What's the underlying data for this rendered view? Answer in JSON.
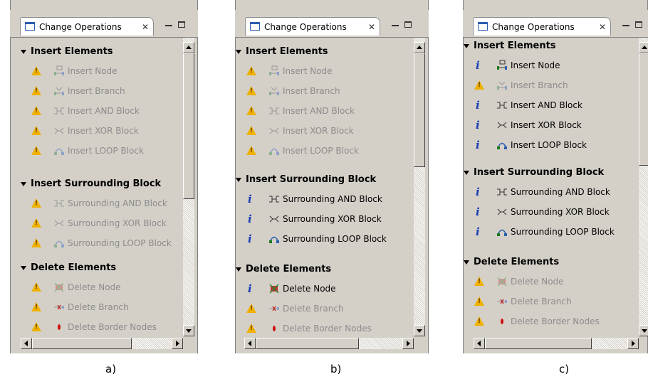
{
  "panels": [
    {
      "tab_title": "Change Operations",
      "sections": [
        {
          "title": "Insert Elements",
          "items": [
            {
              "label": "Insert Node",
              "status": "warning",
              "enabled": false,
              "icon": "insert-node-icon"
            },
            {
              "label": "Insert Branch",
              "status": "warning",
              "enabled": false,
              "icon": "insert-branch-icon"
            },
            {
              "label": "Insert AND Block",
              "status": "warning",
              "enabled": false,
              "icon": "and-block-icon"
            },
            {
              "label": "Insert XOR Block",
              "status": "warning",
              "enabled": false,
              "icon": "xor-block-icon"
            },
            {
              "label": "Insert LOOP Block",
              "status": "warning",
              "enabled": false,
              "icon": "loop-block-icon"
            }
          ]
        },
        {
          "title": "Insert Surrounding Block",
          "items": [
            {
              "label": "Surrounding AND Block",
              "status": "warning",
              "enabled": false,
              "icon": "and-block-icon"
            },
            {
              "label": "Surrounding XOR Block",
              "status": "warning",
              "enabled": false,
              "icon": "xor-block-icon"
            },
            {
              "label": "Surrounding LOOP Block",
              "status": "warning",
              "enabled": false,
              "icon": "loop-block-icon"
            }
          ]
        },
        {
          "title": "Delete Elements",
          "items": [
            {
              "label": "Delete Node",
              "status": "warning",
              "enabled": false,
              "icon": "delete-node-icon"
            },
            {
              "label": "Delete Branch",
              "status": "warning",
              "enabled": false,
              "icon": "delete-branch-icon"
            },
            {
              "label": "Delete Border Nodes",
              "status": "warning",
              "enabled": false,
              "icon": "delete-border-nodes-icon"
            }
          ]
        }
      ],
      "caption": "a)"
    },
    {
      "tab_title": "Change Operations",
      "sections": [
        {
          "title": "Insert Elements",
          "items": [
            {
              "label": "Insert Node",
              "status": "warning",
              "enabled": false,
              "icon": "insert-node-icon"
            },
            {
              "label": "Insert Branch",
              "status": "warning",
              "enabled": false,
              "icon": "insert-branch-icon"
            },
            {
              "label": "Insert AND Block",
              "status": "warning",
              "enabled": false,
              "icon": "and-block-icon"
            },
            {
              "label": "Insert XOR Block",
              "status": "warning",
              "enabled": false,
              "icon": "xor-block-icon"
            },
            {
              "label": "Insert LOOP Block",
              "status": "warning",
              "enabled": false,
              "icon": "loop-block-icon"
            }
          ]
        },
        {
          "title": "Insert Surrounding Block",
          "items": [
            {
              "label": "Surrounding AND Block",
              "status": "info",
              "enabled": true,
              "icon": "and-block-icon"
            },
            {
              "label": "Surrounding XOR Block",
              "status": "info",
              "enabled": true,
              "icon": "xor-block-icon"
            },
            {
              "label": "Surrounding LOOP Block",
              "status": "info",
              "enabled": true,
              "icon": "loop-block-icon"
            }
          ]
        },
        {
          "title": "Delete Elements",
          "items": [
            {
              "label": "Delete Node",
              "status": "info",
              "enabled": true,
              "icon": "delete-node-icon"
            },
            {
              "label": "Delete Branch",
              "status": "warning",
              "enabled": false,
              "icon": "delete-branch-icon"
            },
            {
              "label": "Delete Border Nodes",
              "status": "warning",
              "enabled": false,
              "icon": "delete-border-nodes-icon"
            }
          ]
        }
      ],
      "caption": "b)"
    },
    {
      "tab_title": "Change Operations",
      "sections": [
        {
          "title": "Insert Elements",
          "items": [
            {
              "label": "Insert Node",
              "status": "info",
              "enabled": true,
              "icon": "insert-node-icon"
            },
            {
              "label": "Insert Branch",
              "status": "warning",
              "enabled": false,
              "icon": "insert-branch-icon"
            },
            {
              "label": "Insert AND Block",
              "status": "info",
              "enabled": true,
              "icon": "and-block-icon"
            },
            {
              "label": "Insert XOR Block",
              "status": "info",
              "enabled": true,
              "icon": "xor-block-icon"
            },
            {
              "label": "Insert LOOP Block",
              "status": "info",
              "enabled": true,
              "icon": "loop-block-icon"
            }
          ]
        },
        {
          "title": "Insert Surrounding Block",
          "items": [
            {
              "label": "Surrounding AND Block",
              "status": "info",
              "enabled": true,
              "icon": "and-block-icon"
            },
            {
              "label": "Surrounding XOR Block",
              "status": "info",
              "enabled": true,
              "icon": "xor-block-icon"
            },
            {
              "label": "Surrounding LOOP Block",
              "status": "info",
              "enabled": true,
              "icon": "loop-block-icon"
            }
          ]
        },
        {
          "title": "Delete Elements",
          "items": [
            {
              "label": "Delete Node",
              "status": "warning",
              "enabled": false,
              "icon": "delete-node-icon"
            },
            {
              "label": "Delete Branch",
              "status": "warning",
              "enabled": false,
              "icon": "delete-branch-icon"
            },
            {
              "label": "Delete Border Nodes",
              "status": "warning",
              "enabled": false,
              "icon": "delete-border-nodes-icon"
            }
          ]
        }
      ],
      "caption": "c)"
    }
  ],
  "colors": {
    "panel_bg": "#d4d0c8",
    "info_blue": "#1a3fb5",
    "warning_yellow": "#f0b000",
    "disabled_text": "#8c8c8c"
  }
}
